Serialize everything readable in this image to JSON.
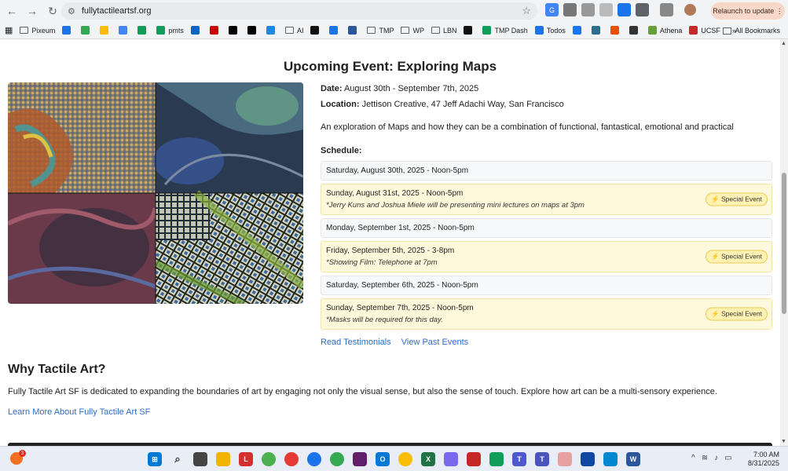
{
  "browser": {
    "url": "fullytactileartsf.org",
    "relaunch_label": "Relaunch to update",
    "bookmarks": [
      {
        "label": "Pixeum",
        "color": "#5f6368",
        "kind": "folder"
      },
      {
        "label": "",
        "color": "#1a73e8",
        "kind": "icon"
      },
      {
        "label": "",
        "color": "#34a853",
        "kind": "icon"
      },
      {
        "label": "",
        "color": "#fbbc04",
        "kind": "icon"
      },
      {
        "label": "",
        "color": "#4285f4",
        "kind": "icon"
      },
      {
        "label": "",
        "color": "#0f9d58",
        "kind": "icon"
      },
      {
        "label": "pmts",
        "color": "#0f9d58",
        "kind": "icon"
      },
      {
        "label": "",
        "color": "#0a66c2",
        "kind": "icon"
      },
      {
        "label": "",
        "color": "#c00",
        "kind": "icon"
      },
      {
        "label": "",
        "color": "#000",
        "kind": "icon"
      },
      {
        "label": "",
        "color": "#000",
        "kind": "icon"
      },
      {
        "label": "",
        "color": "#1e88e5",
        "kind": "icon"
      },
      {
        "label": "AI",
        "color": "#5f6368",
        "kind": "folder"
      },
      {
        "label": "",
        "color": "#111",
        "kind": "icon"
      },
      {
        "label": "",
        "color": "#1a73e8",
        "kind": "icon"
      },
      {
        "label": "",
        "color": "#2b579a",
        "kind": "icon"
      },
      {
        "label": "TMP",
        "color": "#5f6368",
        "kind": "folder"
      },
      {
        "label": "WP",
        "color": "#5f6368",
        "kind": "folder"
      },
      {
        "label": "LBN",
        "color": "#5f6368",
        "kind": "folder"
      },
      {
        "label": "",
        "color": "#111",
        "kind": "icon"
      },
      {
        "label": "TMP Dash",
        "color": "#0f9d58",
        "kind": "icon"
      },
      {
        "label": "Todos",
        "color": "#1a73e8",
        "kind": "icon"
      },
      {
        "label": "",
        "color": "#1877f2",
        "kind": "icon"
      },
      {
        "label": "",
        "color": "#2c6e8f",
        "kind": "icon"
      },
      {
        "label": "",
        "color": "#e65100",
        "kind": "icon"
      },
      {
        "label": "",
        "color": "#333",
        "kind": "icon"
      },
      {
        "label": "Athena",
        "color": "#689f38",
        "kind": "icon"
      },
      {
        "label": "UCSF",
        "color": "#c62828",
        "kind": "icon"
      }
    ],
    "more_label": "»",
    "all_bookmarks_label": "All Bookmarks"
  },
  "event": {
    "title": "Upcoming Event: Exploring Maps",
    "date_label": "Date:",
    "date_value": "August 30th - September 7th, 2025",
    "location_label": "Location:",
    "location_value": "Jettison Creative, 47 Jeff Adachi Way, San Francisco",
    "description": "An exploration of Maps and how they can be a combination of functional, fantastical, emotional and practical",
    "schedule_label": "Schedule:",
    "schedule": [
      {
        "text": "Saturday, August 30th, 2025 - Noon-5pm",
        "note": "",
        "special": false
      },
      {
        "text": "Sunday, August 31st, 2025 - Noon-5pm",
        "note": "*Jerry Kuns and Joshua Miele will be presenting mini lectures on maps at 3pm",
        "special": true
      },
      {
        "text": "Monday, September 1st, 2025 - Noon-5pm",
        "note": "",
        "special": false
      },
      {
        "text": "Friday, September 5th, 2025 - 3-8pm",
        "note": "*Showing Film: Telephone at 7pm",
        "special": true
      },
      {
        "text": "Saturday, September 6th, 2025 - Noon-5pm",
        "note": "",
        "special": false
      },
      {
        "text": "Sunday, September 7th, 2025 - Noon-5pm",
        "note": "*Masks will be required for this day.",
        "special": true
      }
    ],
    "special_badge": "Special Event",
    "testimonials_link": "Read Testimonials",
    "past_events_link": "View Past Events"
  },
  "why": {
    "heading": "Why Tactile Art?",
    "text": "Fully Tactile Art SF is dedicated to expanding the boundaries of art by engaging not only the visual sense, but also the sense of touch. Explore how art can be a multi-sensory experience.",
    "learn_more": "Learn More About Fully Tactile Art SF"
  },
  "taskbar": {
    "weather_badge": "3",
    "time": "7:00 AM",
    "date": "8/31/2025"
  }
}
